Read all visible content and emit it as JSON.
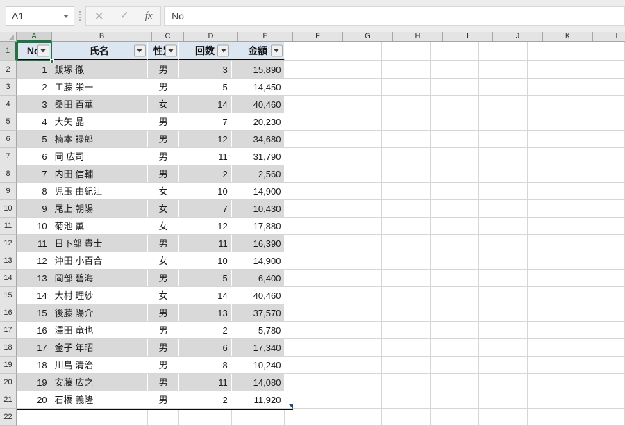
{
  "formula_bar": {
    "name_box_value": "A1",
    "name_box_caret_icon": "chevron-down-icon",
    "separator_icon": "vertical-dots-icon",
    "cancel_icon": "✕",
    "enter_icon": "✓",
    "function_icon": "fx",
    "formula_value": "No"
  },
  "grid": {
    "column_headers": [
      "A",
      "B",
      "C",
      "D",
      "E",
      "F",
      "G",
      "H",
      "I",
      "J",
      "K",
      "L"
    ],
    "selected_column": "A",
    "selected_row": "1",
    "row_headers": [
      "1",
      "2",
      "3",
      "4",
      "5",
      "6",
      "7",
      "8",
      "9",
      "10",
      "11",
      "12",
      "13",
      "14",
      "15",
      "16",
      "17",
      "18",
      "19",
      "20",
      "21",
      "22"
    ],
    "selected_cell": "A1"
  },
  "table": {
    "headers": [
      "No",
      "氏名",
      "性別",
      "回数",
      "金額"
    ],
    "filter_icon": "filter-dropdown-icon",
    "header_fill": "#DCE6F1",
    "band_fill": "#D9D9D9",
    "rows": [
      {
        "no": "1",
        "name": "飯塚 徹",
        "gender": "男",
        "count": "3",
        "amount": "15,890"
      },
      {
        "no": "2",
        "name": "工藤 栄一",
        "gender": "男",
        "count": "5",
        "amount": "14,450"
      },
      {
        "no": "3",
        "name": "桑田 百華",
        "gender": "女",
        "count": "14",
        "amount": "40,460"
      },
      {
        "no": "4",
        "name": "大矢 晶",
        "gender": "男",
        "count": "7",
        "amount": "20,230"
      },
      {
        "no": "5",
        "name": "楠本 禄郎",
        "gender": "男",
        "count": "12",
        "amount": "34,680"
      },
      {
        "no": "6",
        "name": "岡 広司",
        "gender": "男",
        "count": "11",
        "amount": "31,790"
      },
      {
        "no": "7",
        "name": "内田 信輔",
        "gender": "男",
        "count": "2",
        "amount": "2,560"
      },
      {
        "no": "8",
        "name": "児玉 由紀江",
        "gender": "女",
        "count": "10",
        "amount": "14,900"
      },
      {
        "no": "9",
        "name": "尾上 朝陽",
        "gender": "女",
        "count": "7",
        "amount": "10,430"
      },
      {
        "no": "10",
        "name": "菊池 薫",
        "gender": "女",
        "count": "12",
        "amount": "17,880"
      },
      {
        "no": "11",
        "name": "日下部 貴士",
        "gender": "男",
        "count": "11",
        "amount": "16,390"
      },
      {
        "no": "12",
        "name": "沖田 小百合",
        "gender": "女",
        "count": "10",
        "amount": "14,900"
      },
      {
        "no": "13",
        "name": "岡部 碧海",
        "gender": "男",
        "count": "5",
        "amount": "6,400"
      },
      {
        "no": "14",
        "name": "大村 理紗",
        "gender": "女",
        "count": "14",
        "amount": "40,460"
      },
      {
        "no": "15",
        "name": "後藤 陽介",
        "gender": "男",
        "count": "13",
        "amount": "37,570"
      },
      {
        "no": "16",
        "name": "澤田 竜也",
        "gender": "男",
        "count": "2",
        "amount": "5,780"
      },
      {
        "no": "17",
        "name": "金子 年昭",
        "gender": "男",
        "count": "6",
        "amount": "17,340"
      },
      {
        "no": "18",
        "name": "川島 清治",
        "gender": "男",
        "count": "8",
        "amount": "10,240"
      },
      {
        "no": "19",
        "name": "安藤 広之",
        "gender": "男",
        "count": "11",
        "amount": "14,080"
      },
      {
        "no": "20",
        "name": "石橋 義隆",
        "gender": "男",
        "count": "2",
        "amount": "11,920"
      }
    ]
  }
}
